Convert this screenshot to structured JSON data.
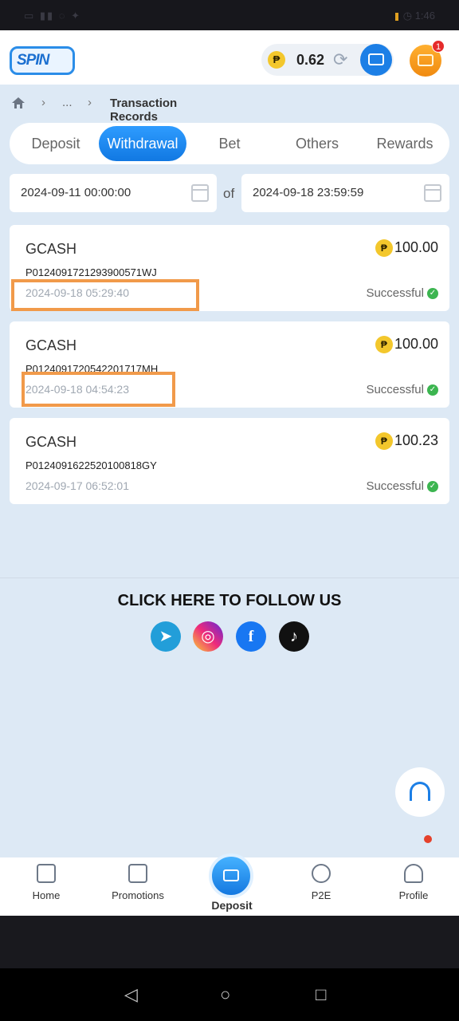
{
  "status_bar": {
    "left": "▭ ▮▮ ◌ ✦",
    "right": "◷ 1:46"
  },
  "header": {
    "logo": "SPIN",
    "balance": "0.62",
    "currency_symbol": "₱",
    "notification_count": "1"
  },
  "breadcrumb": {
    "ellipsis": "...",
    "title": "Transaction Records"
  },
  "tabs": [
    "Deposit",
    "Withdrawal",
    "Bet",
    "Others",
    "Rewards"
  ],
  "active_tab": "Withdrawal",
  "filter": {
    "start": "2024-09-11 00:00:00",
    "separator": "of",
    "end": "2024-09-18 23:59:59"
  },
  "records": [
    {
      "method": "GCASH",
      "amount": "100.00",
      "txid": "P0124091721293900571WJ",
      "time": "2024-09-18 05:29:40",
      "status": "Successful"
    },
    {
      "method": "GCASH",
      "amount": "100.00",
      "txid": "P0124091720542201717MH",
      "time": "2024-09-18 04:54:23",
      "status": "Successful"
    },
    {
      "method": "GCASH",
      "amount": "100.23",
      "txid": "P0124091622520100818GY",
      "time": "2024-09-17 06:52:01",
      "status": "Successful"
    }
  ],
  "follow": {
    "title": "CLICK HERE TO FOLLOW US"
  },
  "bottom_nav": {
    "home": "Home",
    "promotions": "Promotions",
    "deposit": "Deposit",
    "p2e": "P2E",
    "profile": "Profile"
  },
  "colors": {
    "accent": "#1c7fe6",
    "background": "#dde9f5",
    "highlight": "#f19a4a",
    "success": "#3cb550"
  }
}
